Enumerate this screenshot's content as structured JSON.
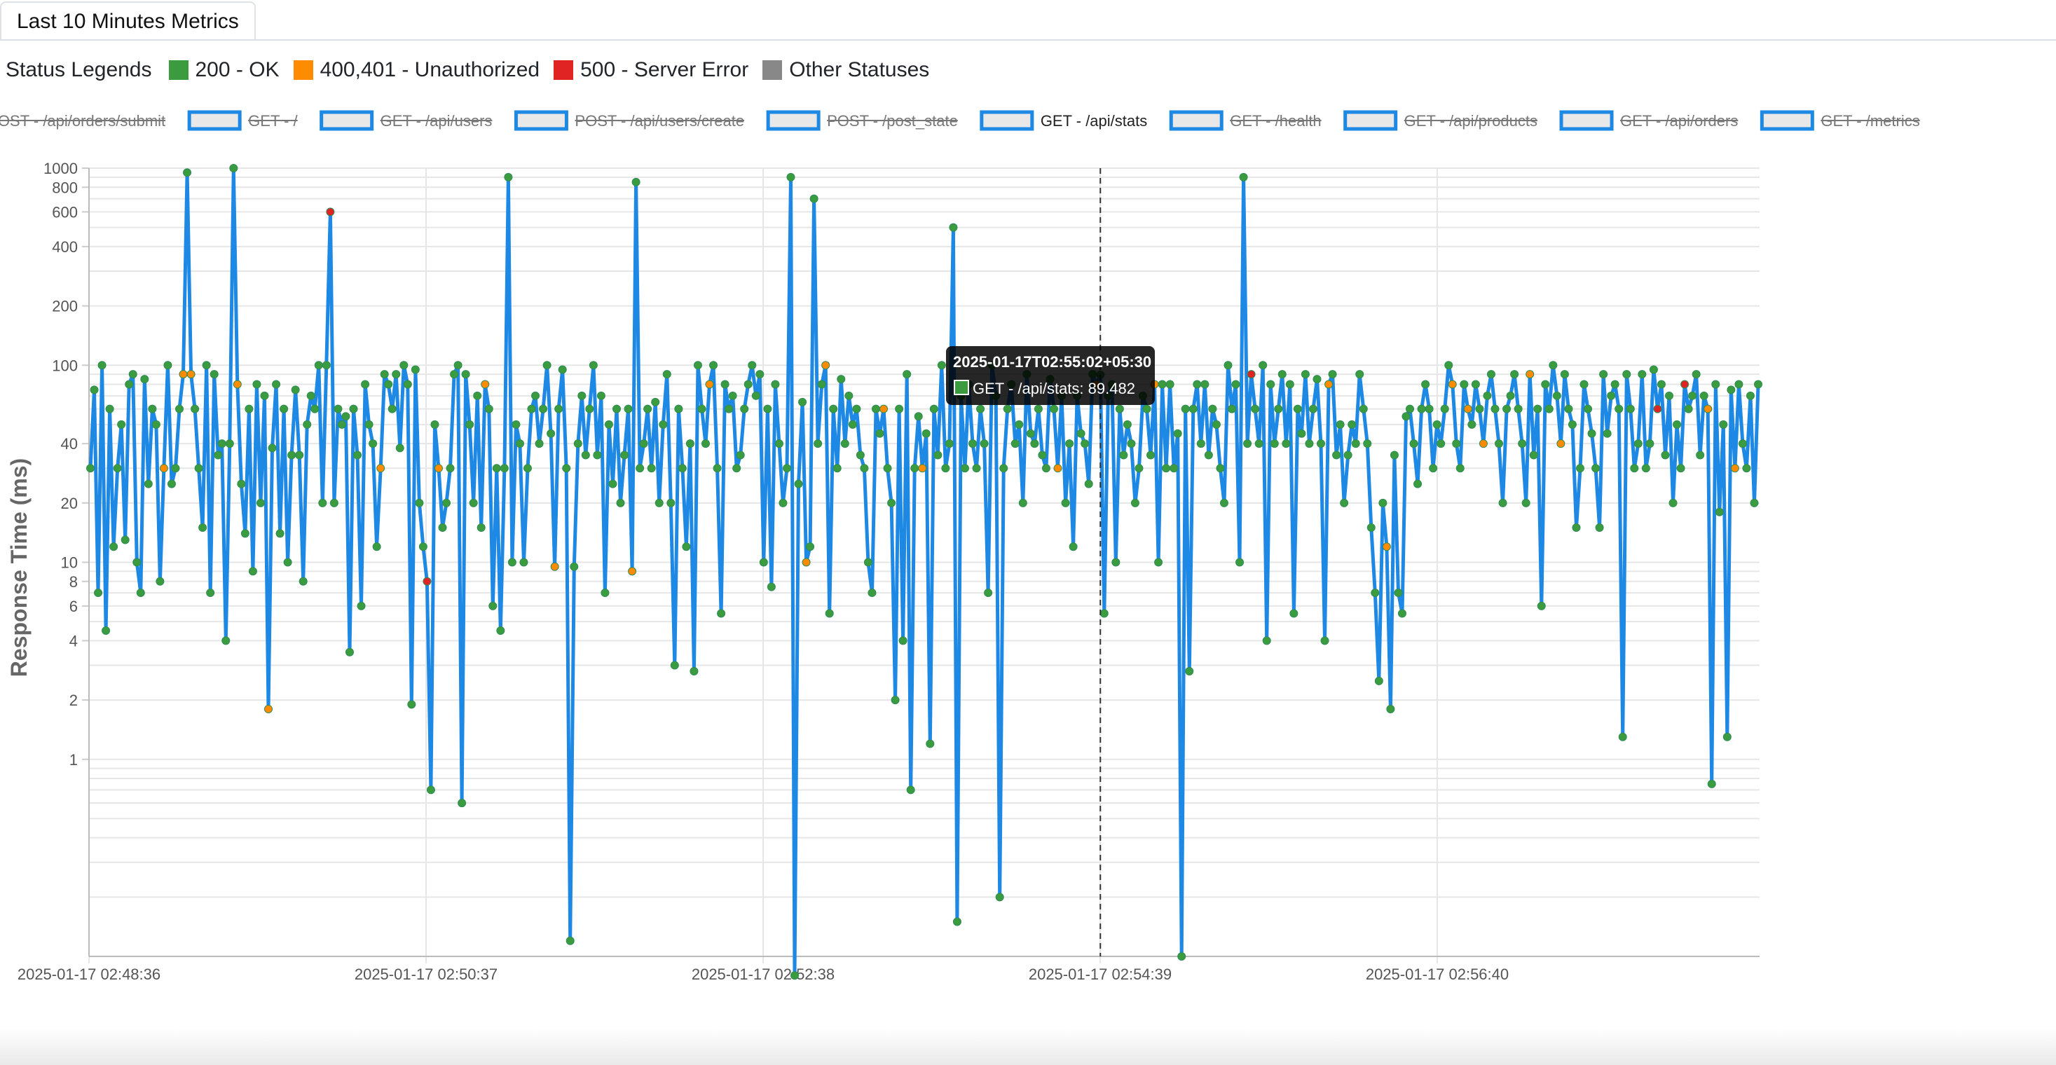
{
  "tab": {
    "label": "Last 10 Minutes Metrics"
  },
  "status_legend": {
    "title": "Status Legends",
    "items": [
      {
        "label": "200 - OK",
        "color": "#3a9c3f"
      },
      {
        "label": "400,401 - Unauthorized",
        "color": "#ff8c00"
      },
      {
        "label": "500 - Server Error",
        "color": "#e02424"
      },
      {
        "label": "Other Statuses",
        "color": "#888888"
      }
    ]
  },
  "tooltip": {
    "title": "2025-01-17T02:55:02+05:30",
    "body": "GET - /api/stats: 89.482",
    "swatch_color": "#3a9c3f"
  },
  "chart_data": {
    "type": "line",
    "ylabel": "Response Time (ms)",
    "y_scale": "log",
    "ylim": [
      0.1,
      1000
    ],
    "y_ticks": [
      1000,
      800,
      600,
      400,
      200,
      100,
      40,
      20,
      10,
      8,
      6,
      4,
      2,
      1
    ],
    "x_ticks": [
      "2025-01-17 02:48:36",
      "2025-01-17 02:50:37",
      "2025-01-17 02:52:38",
      "2025-01-17 02:54:39",
      "2025-01-17 02:56:40"
    ],
    "line_color": "#1e88e5",
    "hover_time": "2025-01-17T02:55:02+05:30",
    "series": [
      {
        "name": "POST - /api/orders/submit",
        "hidden": true
      },
      {
        "name": "GET - /",
        "hidden": true
      },
      {
        "name": "GET - /api/users",
        "hidden": true
      },
      {
        "name": "POST - /api/users/create",
        "hidden": true
      },
      {
        "name": "POST - /post_state",
        "hidden": true
      },
      {
        "name": "GET - /api/stats",
        "hidden": false,
        "values": [
          30,
          75,
          7,
          100,
          4.5,
          60,
          12,
          30,
          50,
          13,
          80,
          90,
          10,
          7,
          85,
          25,
          60,
          50,
          8,
          30,
          100,
          25,
          30,
          60,
          90,
          950,
          90,
          60,
          30,
          15,
          100,
          7,
          90,
          35,
          40,
          4,
          40,
          1000,
          80,
          25,
          14,
          60,
          9,
          80,
          20,
          70,
          1.8,
          38,
          80,
          14,
          60,
          10,
          35,
          75,
          35,
          8,
          50,
          70,
          60,
          100,
          20,
          100,
          600,
          20,
          60,
          50,
          55,
          3.5,
          60,
          35,
          6,
          80,
          50,
          40,
          12,
          30,
          90,
          80,
          60,
          90,
          38,
          100,
          80,
          1.9,
          95,
          20,
          12,
          8,
          0.7,
          50,
          30,
          15,
          20,
          30,
          90,
          100,
          0.6,
          90,
          50,
          20,
          70,
          15,
          80,
          60,
          6,
          30,
          4.5,
          30,
          900,
          10,
          50,
          40,
          10,
          30,
          60,
          70,
          40,
          60,
          100,
          45,
          9.5,
          60,
          95,
          30,
          0.12,
          9.5,
          40,
          70,
          35,
          60,
          100,
          35,
          70,
          7,
          50,
          25,
          60,
          20,
          35,
          60,
          9,
          850,
          30,
          40,
          60,
          30,
          65,
          20,
          50,
          90,
          20,
          3,
          60,
          30,
          12,
          40,
          2.8,
          100,
          60,
          40,
          80,
          100,
          30,
          5.5,
          80,
          60,
          70,
          30,
          35,
          60,
          80,
          100,
          70,
          90,
          10,
          60,
          7.5,
          80,
          40,
          20,
          30,
          900,
          0.08,
          25,
          65,
          10,
          12,
          700,
          40,
          80,
          100,
          5.5,
          60,
          30,
          85,
          40,
          70,
          50,
          60,
          35,
          30,
          10,
          7,
          60,
          45,
          60,
          30,
          20,
          2,
          60,
          4,
          90,
          0.7,
          30,
          55,
          30,
          45,
          1.2,
          60,
          35,
          100,
          30,
          40,
          500,
          0.15,
          70,
          30,
          80,
          40,
          30,
          60,
          40,
          7,
          100,
          70,
          0.2,
          30,
          60,
          80,
          40,
          50,
          20,
          90,
          45,
          40,
          60,
          35,
          30,
          85,
          60,
          30,
          70,
          20,
          40,
          12,
          70,
          45,
          40,
          25,
          90,
          80,
          89.482,
          5.5,
          70,
          80,
          10,
          60,
          35,
          50,
          40,
          20,
          30,
          70,
          60,
          35,
          80,
          10,
          80,
          30,
          80,
          30,
          45,
          0.1,
          60,
          2.8,
          60,
          80,
          40,
          80,
          35,
          60,
          50,
          30,
          20,
          100,
          60,
          80,
          10,
          900,
          40,
          90,
          60,
          40,
          100,
          4,
          80,
          40,
          60,
          90,
          40,
          80,
          5.5,
          60,
          45,
          90,
          40,
          60,
          85,
          40,
          4,
          80,
          90,
          35,
          50,
          20,
          35,
          50,
          40,
          90,
          60,
          40,
          15,
          7,
          2.5,
          20,
          12,
          1.8,
          35,
          7,
          5.5,
          55,
          60,
          40,
          25,
          60,
          80,
          60,
          30,
          50,
          40,
          60,
          100,
          80,
          40,
          30,
          80,
          60,
          50,
          80,
          60,
          40,
          70,
          90,
          60,
          40,
          20,
          60,
          70,
          90,
          60,
          40,
          20,
          90,
          35,
          60,
          6,
          80,
          60,
          100,
          70,
          40,
          90,
          60,
          50,
          15,
          30,
          80,
          60,
          45,
          30,
          15,
          90,
          45,
          70,
          80,
          60,
          1.3,
          90,
          60,
          30,
          40,
          90,
          30,
          40,
          95,
          60,
          80,
          35,
          70,
          20,
          50,
          30,
          80,
          60,
          70,
          90,
          35,
          70,
          60,
          0.75,
          80,
          18,
          50,
          1.3,
          75,
          30,
          80,
          40,
          30,
          70,
          20,
          80
        ],
        "status_markers": [
          {
            "index": 19,
            "status": "400,401 - Unauthorized"
          },
          {
            "index": 24,
            "status": "400,401 - Unauthorized"
          },
          {
            "index": 26,
            "status": "400,401 - Unauthorized"
          },
          {
            "index": 38,
            "status": "400,401 - Unauthorized"
          },
          {
            "index": 46,
            "status": "400,401 - Unauthorized"
          },
          {
            "index": 62,
            "status": "500 - Server Error"
          },
          {
            "index": 75,
            "status": "400,401 - Unauthorized"
          },
          {
            "index": 87,
            "status": "500 - Server Error"
          },
          {
            "index": 90,
            "status": "400,401 - Unauthorized"
          },
          {
            "index": 102,
            "status": "400,401 - Unauthorized"
          },
          {
            "index": 120,
            "status": "400,401 - Unauthorized"
          },
          {
            "index": 140,
            "status": "400,401 - Unauthorized"
          },
          {
            "index": 160,
            "status": "400,401 - Unauthorized"
          },
          {
            "index": 185,
            "status": "400,401 - Unauthorized"
          },
          {
            "index": 190,
            "status": "400,401 - Unauthorized"
          },
          {
            "index": 205,
            "status": "400,401 - Unauthorized"
          },
          {
            "index": 215,
            "status": "400,401 - Unauthorized"
          },
          {
            "index": 250,
            "status": "400,401 - Unauthorized"
          },
          {
            "index": 260,
            "status": "400,401 - Unauthorized"
          },
          {
            "index": 275,
            "status": "400,401 - Unauthorized"
          },
          {
            "index": 300,
            "status": "500 - Server Error"
          },
          {
            "index": 320,
            "status": "400,401 - Unauthorized"
          },
          {
            "index": 335,
            "status": "400,401 - Unauthorized"
          },
          {
            "index": 352,
            "status": "400,401 - Unauthorized"
          },
          {
            "index": 356,
            "status": "400,401 - Unauthorized"
          },
          {
            "index": 360,
            "status": "400,401 - Unauthorized"
          },
          {
            "index": 372,
            "status": "400,401 - Unauthorized"
          },
          {
            "index": 380,
            "status": "400,401 - Unauthorized"
          },
          {
            "index": 405,
            "status": "500 - Server Error"
          },
          {
            "index": 412,
            "status": "500 - Server Error"
          },
          {
            "index": 418,
            "status": "400,401 - Unauthorized"
          },
          {
            "index": 425,
            "status": "400,401 - Unauthorized"
          },
          {
            "index": 432,
            "status": "500 - Server Error"
          }
        ]
      },
      {
        "name": "GET - /health",
        "hidden": true
      },
      {
        "name": "GET - /api/products",
        "hidden": true
      },
      {
        "name": "GET - /api/orders",
        "hidden": true
      },
      {
        "name": "GET - /metrics",
        "hidden": true
      }
    ]
  }
}
